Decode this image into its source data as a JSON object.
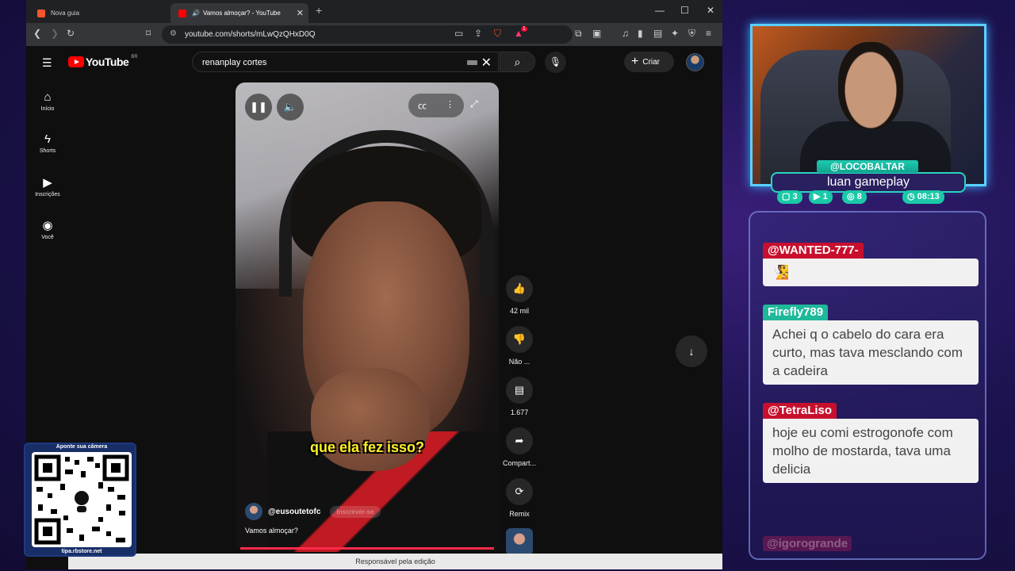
{
  "browser": {
    "tabs": [
      {
        "title": "Nova guia",
        "active": false
      },
      {
        "title": "Vamos almoçar? - YouTube",
        "active": true
      }
    ],
    "url": "youtube.com/shorts/mLwQzQHxD0Q",
    "extension_badge": "1"
  },
  "youtube": {
    "logo_text": "YouTube",
    "country_code": "BR",
    "search_query": "renanplay cortes",
    "create_label": "Criar",
    "sidebar": [
      {
        "label": "Início",
        "icon": "home-icon"
      },
      {
        "label": "Shorts",
        "icon": "shorts-icon"
      },
      {
        "label": "Inscrições",
        "icon": "subscriptions-icon"
      },
      {
        "label": "Você",
        "icon": "you-icon"
      }
    ],
    "short": {
      "caption": "que ela fez isso?",
      "channel": "@eusoutetofc",
      "subscribe": "Inscrever-se",
      "title": "Vamos almoçar?"
    },
    "actions": [
      {
        "icon": "like-icon",
        "label": "42 mil"
      },
      {
        "icon": "dislike-icon",
        "label": "Não ..."
      },
      {
        "icon": "comment-icon",
        "label": "1.677"
      },
      {
        "icon": "share-icon",
        "label": "Compart..."
      },
      {
        "icon": "remix-icon",
        "label": "Remix"
      }
    ],
    "footer": "Responsável pela edição"
  },
  "qr": {
    "header": "Aponte sua câmera",
    "footer": "tipa.rbstore.net"
  },
  "stream": {
    "handle": "@LOCOBALTAR",
    "name": "luan gameplay",
    "stats": [
      {
        "icon": "twitch-icon",
        "value": "3"
      },
      {
        "icon": "youtube-icon",
        "value": "1"
      },
      {
        "icon": "kick-icon",
        "value": "8"
      },
      {
        "icon": "clock-icon",
        "value": "08:13"
      }
    ]
  },
  "chat": {
    "messages": [
      {
        "user": "@WANTED-777-",
        "text": "🧏",
        "user_color": "#c8102e"
      },
      {
        "user": "Firefly789",
        "text": "Achei q o cabelo do cara era curto, mas tava mesclando com a cadeira",
        "user_color": "#1fb89a"
      },
      {
        "user": "@TetraLiso",
        "text": "hoje eu comi estrogonofe com molho de mostarda, tava uma delicia",
        "user_color": "#c8102e"
      }
    ],
    "next_user": "@igorogrande"
  },
  "colors": {
    "accent_red": "#ff0000",
    "chat_red": "#c8102e",
    "chat_teal": "#1fb89a",
    "cam_border": "#5ad0ff"
  }
}
